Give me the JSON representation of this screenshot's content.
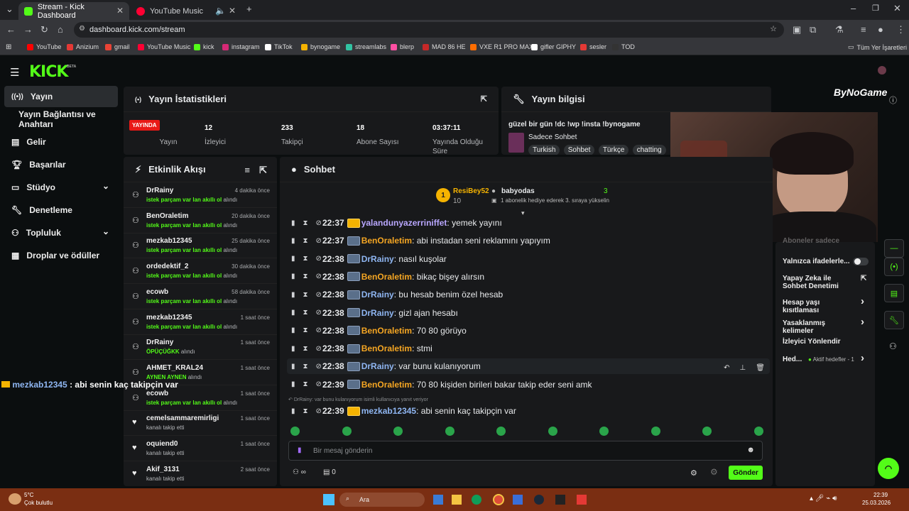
{
  "browser": {
    "tabs": [
      {
        "title": "Stream - Kick Dashboard",
        "favicon_color": "#53fc18"
      },
      {
        "title": "YouTube Music",
        "favicon_color": "#ff0033"
      }
    ],
    "url": "dashboard.kick.com/stream",
    "bookmarks": [
      {
        "label": "YouTube",
        "color": "#ff0000"
      },
      {
        "label": "Anizium",
        "color": "#e53935"
      },
      {
        "label": "gmail",
        "color": "#ea4335"
      },
      {
        "label": "YouTube Music",
        "color": "#ff0033"
      },
      {
        "label": "kick",
        "color": "#53fc18"
      },
      {
        "label": "instagram",
        "color": "#d62976"
      },
      {
        "label": "TikTok",
        "color": "#ffffff"
      },
      {
        "label": "bynogame",
        "color": "#f5b301"
      },
      {
        "label": "streamlabs",
        "color": "#31c3a2"
      },
      {
        "label": "blerp",
        "color": "#ff4fa3"
      },
      {
        "label": "MAD 86 HE",
        "color": "#c62828"
      },
      {
        "label": "VXE R1 PRO MAX",
        "color": "#ff6d00"
      },
      {
        "label": "gifler GIPHY",
        "color": "#ffffff"
      },
      {
        "label": "sesler",
        "color": "#e53935"
      },
      {
        "label": "TOD",
        "color": "#333333"
      }
    ],
    "all_bookmarks": "Tüm Yer İşaretleri"
  },
  "app": {
    "logo": "KICK",
    "beta": "BETA",
    "watermark": "ByNoGame",
    "sidebar": [
      {
        "label": "Yayın",
        "active": true
      },
      {
        "label": "Yayın Bağlantısı ve Anahtarı"
      },
      {
        "label": "Gelir"
      },
      {
        "label": "Başarılar"
      },
      {
        "label": "Stüdyo",
        "chevron": "⌄"
      },
      {
        "label": "Denetleme"
      },
      {
        "label": "Topluluk",
        "chevron": "⌄"
      },
      {
        "label": "Droplar ve ödüller"
      }
    ],
    "stats": {
      "title": "Yayın İstatistikleri",
      "live_badge": "YAYINDA",
      "live_label": "Yayın",
      "items": [
        {
          "value": "12",
          "label": "İzleyici"
        },
        {
          "value": "233",
          "label": "Takipçi"
        },
        {
          "value": "18",
          "label": "Abone Sayısı"
        },
        {
          "value": "03:37:11",
          "label": "Yayında Olduğu Süre"
        }
      ]
    },
    "info": {
      "title": "Yayın bilgisi",
      "stream_title": "güzel bir gün !dc !wp !insta !bynogame",
      "category": "Sadece Sohbet",
      "tags": [
        "Turkish",
        "Sohbet",
        "Türkçe",
        "chatting"
      ]
    },
    "activity": {
      "title": "Etkinlik Akışı",
      "rows": [
        {
          "name": "DrRainy",
          "time": "4 dakika önce",
          "highlight": "istek parçam var lan akıllı ol",
          "suffix": "alındı",
          "icon": "ticket"
        },
        {
          "name": "BenOraletim",
          "time": "20 dakika önce",
          "highlight": "istek parçam var lan akıllı ol",
          "suffix": "alındı",
          "icon": "ticket"
        },
        {
          "name": "mezkab12345",
          "time": "25 dakika önce",
          "highlight": "istek parçam var lan akıllı ol",
          "suffix": "alındı",
          "icon": "ticket"
        },
        {
          "name": "ordedektif_2",
          "time": "30 dakika önce",
          "highlight": "istek parçam var lan akıllı ol",
          "suffix": "alındı",
          "icon": "ticket"
        },
        {
          "name": "ecowb",
          "time": "58 dakika önce",
          "highlight": "istek parçam var lan akıllı ol",
          "suffix": "alındı",
          "icon": "ticket"
        },
        {
          "name": "mezkab12345",
          "time": "1 saat önce",
          "highlight": "istek parçam var lan akıllı ol",
          "suffix": "alındı",
          "icon": "ticket"
        },
        {
          "name": "DrRainy",
          "time": "1 saat önce",
          "highlight": "ÖPÜÇÜĞKK",
          "suffix": "alındı",
          "icon": "ticket"
        },
        {
          "name": "AHMET_KRAL24",
          "time": "1 saat önce",
          "highlight": "AYNEN AYNEN",
          "suffix": "alındı",
          "icon": "ticket"
        },
        {
          "name": "ecowb",
          "time": "1 saat önce",
          "highlight": "istek parçam var lan akıllı ol",
          "suffix": "alındı",
          "icon": "ticket"
        },
        {
          "name": "cemelsammaremirligi",
          "time": "1 saat önce",
          "highlight": "",
          "suffix": "kanalı takip etti",
          "icon": "heart"
        },
        {
          "name": "oquiend0",
          "time": "1 saat önce",
          "highlight": "",
          "suffix": "kanalı takip etti",
          "icon": "heart"
        },
        {
          "name": "Akif_3131",
          "time": "2 saat önce",
          "highlight": "",
          "suffix": "kanalı takip etti",
          "icon": "heart"
        }
      ]
    },
    "chat": {
      "title": "Sohbet",
      "pinned": {
        "rank": "1",
        "gifter": "ResiBey52",
        "gift_count": "10",
        "user": "babyodas",
        "user_count": "3",
        "note": "1 abonelik hediye ederek 3. sıraya yükselin"
      },
      "messages": [
        {
          "time": "22:37",
          "user": "yalandunyazerriniffet",
          "color": "#b9a7ff",
          "text": "yemek yayını"
        },
        {
          "time": "22:37",
          "user": "BenOraletim",
          "color": "#f5a623",
          "text": "abi instadan seni reklamını yapıyım"
        },
        {
          "time": "22:38",
          "user": "DrRainy",
          "color": "#8fb6f2",
          "text": "nasıl kuşolar"
        },
        {
          "time": "22:38",
          "user": "BenOraletim",
          "color": "#f5a623",
          "text": "bikaç bişey alırsın"
        },
        {
          "time": "22:38",
          "user": "DrRainy",
          "color": "#8fb6f2",
          "text": "bu hesab benim özel hesab"
        },
        {
          "time": "22:38",
          "user": "DrRainy",
          "color": "#8fb6f2",
          "text": "gizl ajan hesabı"
        },
        {
          "time": "22:38",
          "user": "BenOraletim",
          "color": "#f5a623",
          "text": "70 80 görüyo"
        },
        {
          "time": "22:38",
          "user": "BenOraletim",
          "color": "#f5a623",
          "text": "stmi"
        },
        {
          "time": "22:38",
          "user": "DrRainy",
          "color": "#8fb6f2",
          "text": "var bunu kulanıyorum"
        },
        {
          "time": "22:39",
          "user": "BenOraletim",
          "color": "#f5a623",
          "text": "70 80 kişiden birileri bakar takip eder seni amk"
        }
      ],
      "reply_context": "DrRainy: var bunu kulanıyorum isimli kullanıcıya yanıt veriyor",
      "last": {
        "time": "22:39",
        "user": "mezkab12345",
        "color": "#8fb6f2",
        "text": "abi senin kaç takipçin var"
      },
      "input_placeholder": "Bir mesaj gönderin",
      "infinity": "∞",
      "points": "0",
      "send": "Gönder"
    },
    "overlay_msg": {
      "user": "mezkab12345",
      "text": " : abi senin kaç takipçin var"
    },
    "right_panel": [
      {
        "label": "Aboneler sadece"
      },
      {
        "label": "Yalnızca ifadelerle..."
      },
      {
        "label": "Yapay Zeka ile Sohbet Denetimi"
      },
      {
        "label": "Hesap yaşı kısıtlaması"
      },
      {
        "label": "Yasaklanmış kelimeler"
      },
      {
        "label": "İzleyici Yönlendir"
      },
      {
        "label": "Hed...",
        "extra": "Aktif hedefler - 1"
      }
    ]
  },
  "taskbar": {
    "weather_temp": "5°C",
    "weather_desc": "Çok bulutlu",
    "search": "Ara",
    "time": "22:39",
    "date": "25.03.2026"
  }
}
